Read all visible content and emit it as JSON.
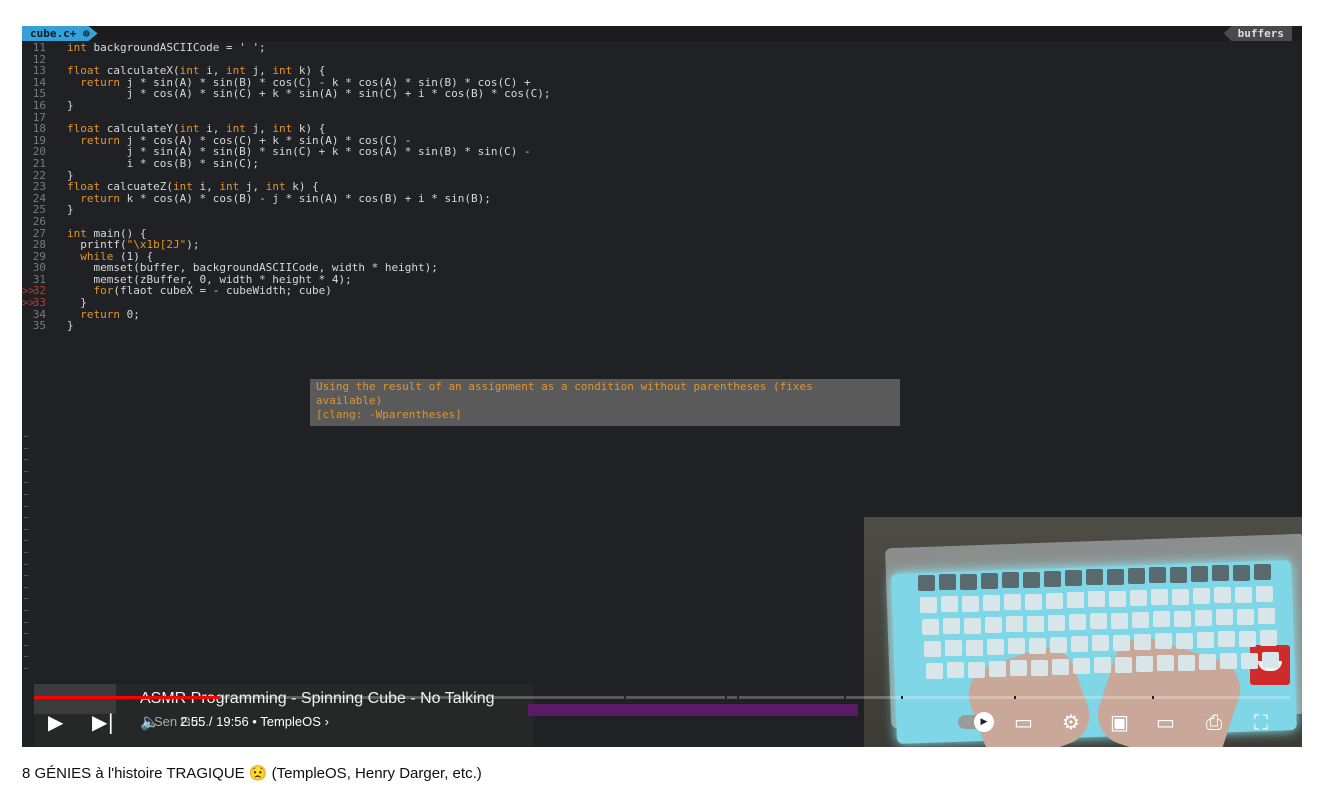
{
  "editor": {
    "file_tab": "cube.c+ ⊗",
    "buffers_tab": "buffers",
    "lines": [
      {
        "n": "11",
        "code": "int backgroundASCIICode = ' ';"
      },
      {
        "n": "12",
        "code": ""
      },
      {
        "n": "13",
        "code": "float calculateX(int i, int j, int k) {"
      },
      {
        "n": "14",
        "code": "  return j * sin(A) * sin(B) * cos(C) - k * cos(A) * sin(B) * cos(C) +"
      },
      {
        "n": "15",
        "code": "         j * cos(A) * sin(C) + k * sin(A) * sin(C) + i * cos(B) * cos(C);"
      },
      {
        "n": "16",
        "code": "}"
      },
      {
        "n": "17",
        "code": ""
      },
      {
        "n": "18",
        "code": "float calculateY(int i, int j, int k) {"
      },
      {
        "n": "19",
        "code": "  return j * cos(A) * cos(C) + k * sin(A) * cos(C) -"
      },
      {
        "n": "20",
        "code": "         j * sin(A) * sin(B) * sin(C) + k * cos(A) * sin(B) * sin(C) -"
      },
      {
        "n": "21",
        "code": "         i * cos(B) * sin(C);"
      },
      {
        "n": "22",
        "code": "}"
      },
      {
        "n": "23",
        "code": "float calcuateZ(int i, int j, int k) {"
      },
      {
        "n": "24",
        "code": "  return k * cos(A) * cos(B) - j * sin(A) * cos(B) + i * sin(B);"
      },
      {
        "n": "25",
        "code": "}"
      },
      {
        "n": "26",
        "code": ""
      },
      {
        "n": "27",
        "code": "int main() {"
      },
      {
        "n": "28",
        "code": "  printf(\"\\x1b[2J\");"
      },
      {
        "n": "29",
        "code": "  while (1) {"
      },
      {
        "n": "30",
        "code": "    memset(buffer, backgroundASCIICode, width * height);"
      },
      {
        "n": "31",
        "code": "    memset(zBuffer, 0, width * height * 4);"
      },
      {
        "n": "32",
        "code": "    for(flaot cubeX = - cubeWidth; cube)",
        "marker": ">>"
      },
      {
        "n": "33",
        "code": "  }",
        "marker": ">>"
      },
      {
        "n": "34",
        "code": "  return 0;"
      },
      {
        "n": "35",
        "code": "}"
      }
    ],
    "diagnostic": "Using the result of an assignment as a condition without parentheses (fixes\navailable)\n[clang: -Wparentheses]"
  },
  "player": {
    "video_title": "ASMR Programming - Spinning Cube - No Talking",
    "current_time": "2:55 / 19:56",
    "chapter": "TempleOS",
    "chapter_chevron": "›",
    "channel_overlay": "Sen Gu...",
    "progress_fraction": 0.147,
    "autoplay_on": true,
    "icons": [
      "play-icon",
      "next-icon",
      "volume-icon",
      "autoplay-toggle",
      "subtitles-icon",
      "settings-icon",
      "miniplayer-icon",
      "theater-icon",
      "cast-icon",
      "fullscreen-icon"
    ]
  },
  "page": {
    "title": "8 GÉNIES à l'histoire TRAGIQUE 😟 (TempleOS, Henry Darger, etc.)"
  },
  "colors": {
    "accent_red": "#ff0000",
    "editor_bg": "#202124",
    "keyword": "#e0952c",
    "tab_blue": "#36a0d8"
  }
}
